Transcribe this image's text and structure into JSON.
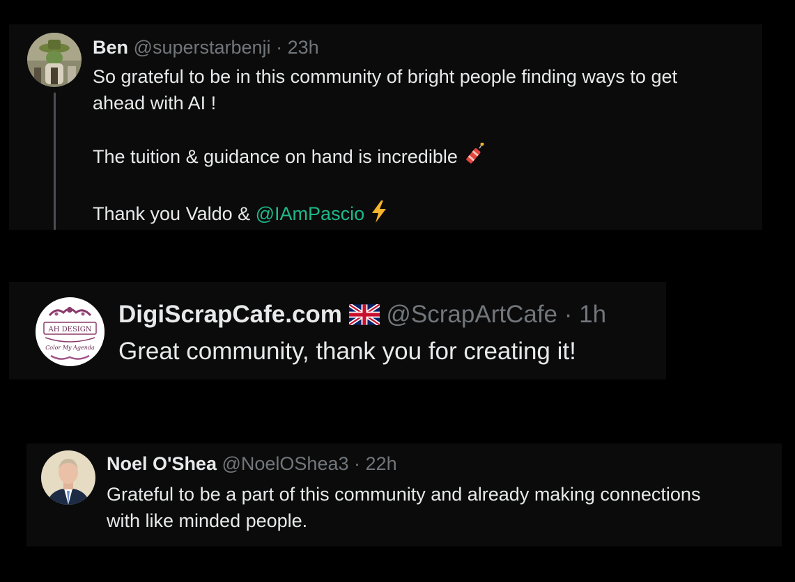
{
  "posts": [
    {
      "author_name": "Ben",
      "handle": "@superstarbenji",
      "separator": "·",
      "time": "23h",
      "lines": [
        "So grateful to be in this community of bright people finding ways to get",
        "ahead with AI !",
        "The tuition & guidance on hand is incredible"
      ],
      "thanks_prefix": "Thank you Valdo & ",
      "mention": "@IAmPascio",
      "emoji_1": "firecracker-emoji",
      "emoji_2": "lightning-emoji"
    },
    {
      "author_name": "DigiScrapCafe.com",
      "flag": "uk-flag-emoji",
      "handle": "@ScrapArtCafe",
      "separator": "·",
      "time": "1h",
      "text": "Great community, thank you for creating it!",
      "avatar_text_top": "AH DESIGN",
      "avatar_text_bottom": "Color My Agenda"
    },
    {
      "author_name": "Noel O'Shea",
      "handle": "@NoelOShea3",
      "separator": "·",
      "time": "22h",
      "lines": [
        "Grateful to be a part of this community and already making connections",
        "with like minded people."
      ]
    }
  ],
  "colors": {
    "background": "#000000",
    "card": "#0b0b0b",
    "text": "#e7e9ea",
    "muted": "#71767b",
    "mention": "#1db98a"
  }
}
